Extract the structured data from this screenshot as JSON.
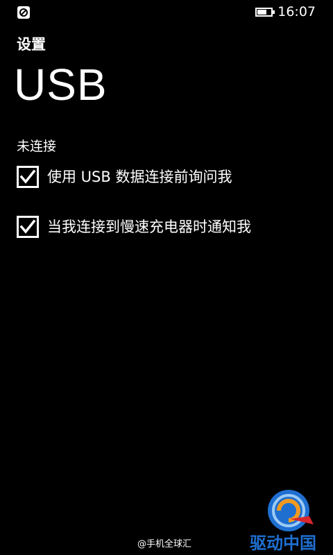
{
  "status_bar": {
    "left_icon": "phone-sync-icon",
    "battery_icon": "battery-icon",
    "battery_level": 0.7,
    "time": "16:07"
  },
  "header": {
    "section": "设置",
    "title": "USB"
  },
  "connection": {
    "status": "未连接"
  },
  "options": [
    {
      "label": "使用 USB 数据连接前询问我",
      "checked": true
    },
    {
      "label": "当我连接到慢速充电器时通知我",
      "checked": true
    }
  ],
  "watermark": {
    "text": "@手机全球汇",
    "logo_icon": "qudong-logo-icon",
    "logo_text": "驱动中国"
  },
  "colors": {
    "background": "#000000",
    "foreground": "#ffffff",
    "logo_blue": "#1f6fd1",
    "logo_orange": "#f29a1f",
    "logo_red": "#d8262b"
  }
}
